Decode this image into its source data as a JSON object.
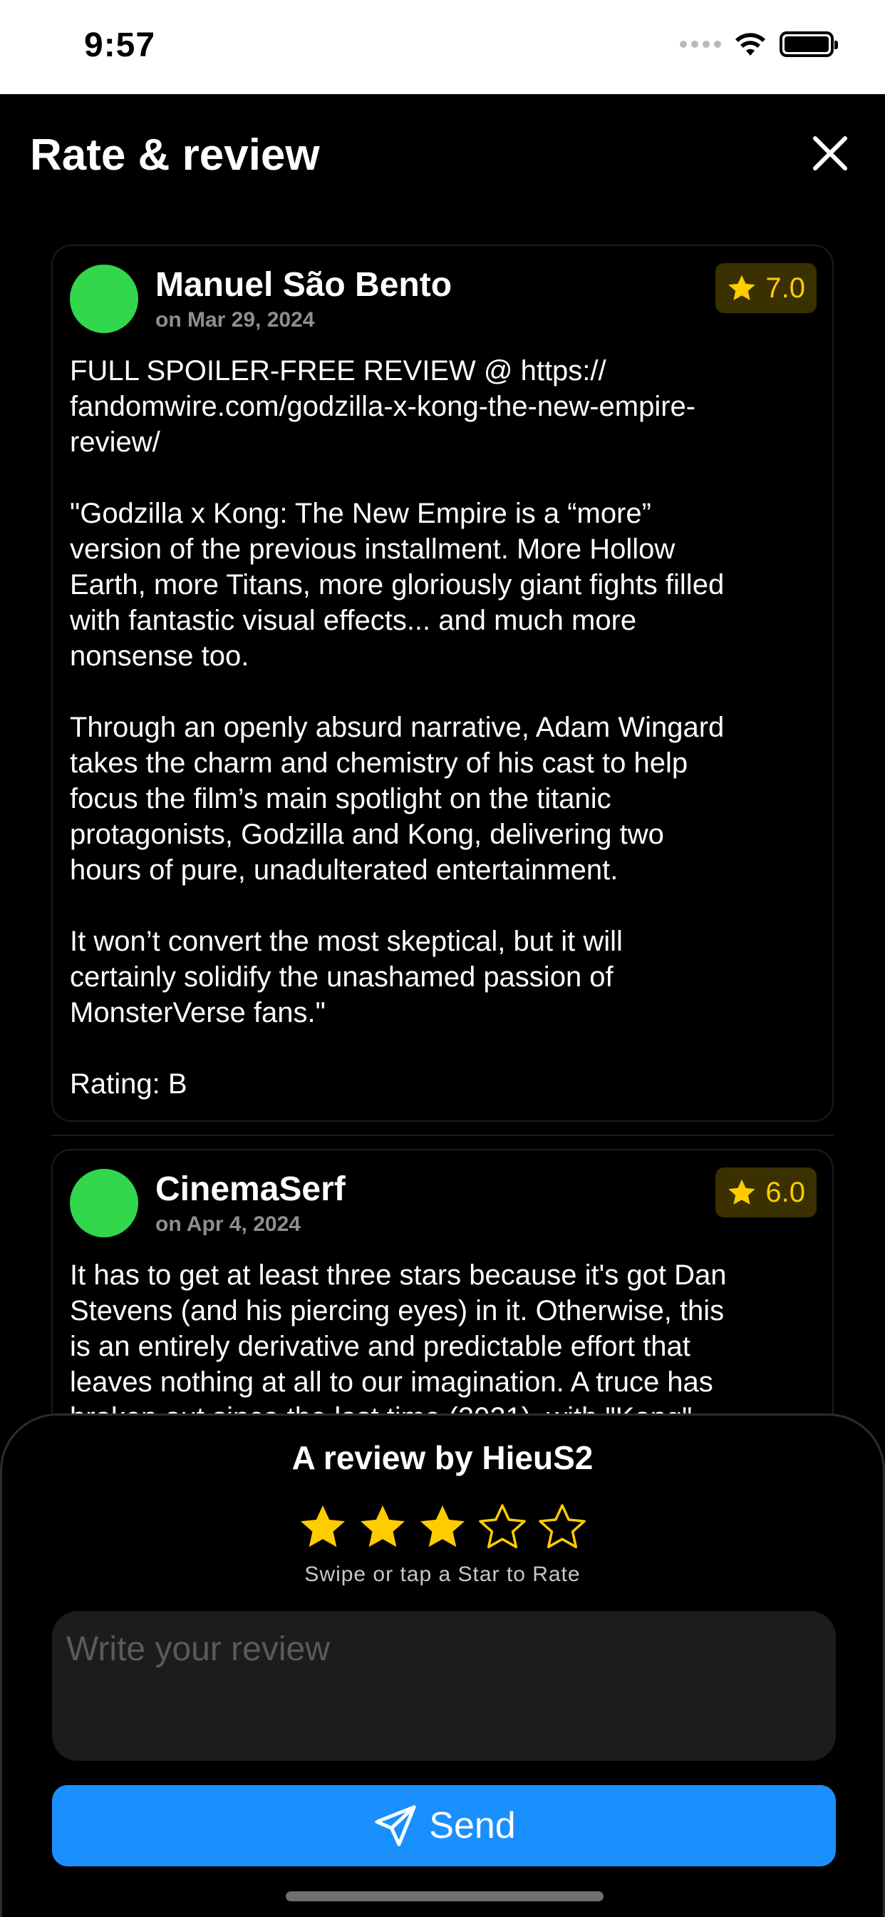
{
  "status_bar": {
    "time": "9:57"
  },
  "header": {
    "title": "Rate & review"
  },
  "reviews": [
    {
      "author": "Manuel São Bento",
      "date": "on Mar 29, 2024",
      "rating": "7.0",
      "text": "FULL SPOILER-FREE REVIEW @ https://\nfandomwire.com/godzilla-x-kong-the-new-empire-\nreview/\n\n\"Godzilla x Kong: The New Empire is a “more”\nversion of the previous installment. More Hollow\nEarth, more Titans, more gloriously giant fights filled\nwith fantastic visual effects... and much more\nnonsense too.\n\nThrough an openly absurd narrative, Adam Wingard\ntakes the charm and chemistry of his cast to help\nfocus the film’s main spotlight on the titanic\nprotagonists, Godzilla and Kong, delivering two\nhours of pure, unadulterated entertainment.\n\nIt won’t convert the most skeptical, but it will\ncertainly solidify the unashamed passion of\nMonsterVerse fans.\"\n\nRating: B"
    },
    {
      "author": "CinemaSerf",
      "date": "on Apr 4, 2024",
      "rating": "6.0",
      "text": "It has to get at least three stars because it's got Dan\nStevens (and his piercing eyes) in it. Otherwise, this\nis an entirely derivative and predictable effort that\nleaves nothing at all to our imagination. A truce has\nbroken out since the last time (2021), with \"Kong\""
    }
  ],
  "review_form": {
    "title": "A review by HieuS2",
    "rating_selected": 3,
    "rating_max": 5,
    "hint": "Swipe or tap a Star to Rate",
    "input_placeholder": "Write your review",
    "input_value": "",
    "send_label": "Send"
  },
  "colors": {
    "accent": "#1a90ff",
    "star": "#ffcc00",
    "avatar": "#32d74b",
    "badge_bg": "#3a3000"
  },
  "icons": {
    "close": "close-icon",
    "star": "star-icon",
    "send": "paper-plane-icon",
    "wifi": "wifi-icon",
    "battery": "battery-icon",
    "signal": "signal-icon"
  }
}
